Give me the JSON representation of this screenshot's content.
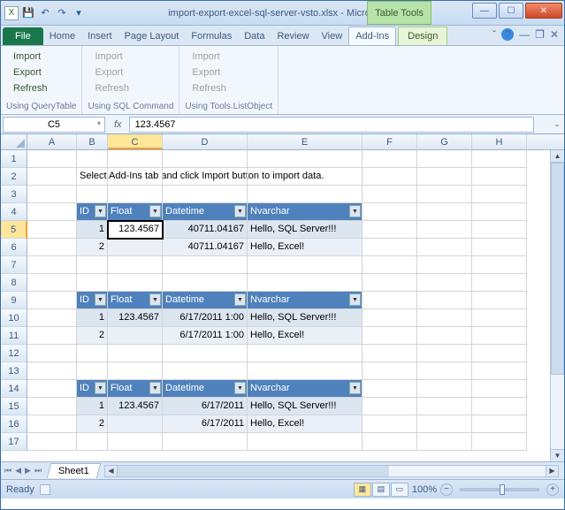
{
  "title": "import-export-excel-sql-server-vsto.xlsx - Microsoft ...",
  "table_tools": "Table Tools",
  "ribbon_tabs": [
    "Home",
    "Insert",
    "Page Layout",
    "Formulas",
    "Data",
    "Review",
    "View",
    "Add-Ins"
  ],
  "active_tab": "Add-Ins",
  "file_tab": "File",
  "design_tab": "Design",
  "ribbon_groups": [
    {
      "label": "Using QueryTable",
      "items": [
        {
          "t": "Import",
          "en": true
        },
        {
          "t": "Export",
          "en": true
        },
        {
          "t": "Refresh",
          "en": true
        }
      ]
    },
    {
      "label": "Using SQL Command",
      "items": [
        {
          "t": "Import",
          "en": false
        },
        {
          "t": "Export",
          "en": false
        },
        {
          "t": "Refresh",
          "en": false
        }
      ]
    },
    {
      "label": "Using Tools.ListObject",
      "items": [
        {
          "t": "Import",
          "en": false
        },
        {
          "t": "Export",
          "en": false
        },
        {
          "t": "Refresh",
          "en": false
        }
      ]
    }
  ],
  "namebox": "C5",
  "formula": "123.4567",
  "columns": [
    "A",
    "B",
    "C",
    "D",
    "E",
    "F",
    "G",
    "H"
  ],
  "selected_col": "C",
  "selected_row": 5,
  "row_count": 17,
  "message": "Select Add-Ins tab  and click Import button to import data.",
  "tables": [
    {
      "header_row": 4,
      "headers": [
        "ID",
        "Float",
        "Datetime",
        "Nvarchar"
      ],
      "rows": [
        {
          "r": 5,
          "v": [
            "1",
            "123.4567",
            "40711.04167",
            "Hello, SQL Server!!!"
          ]
        },
        {
          "r": 6,
          "v": [
            "2",
            "",
            "40711.04167",
            "Hello, Excel!"
          ]
        }
      ]
    },
    {
      "header_row": 9,
      "headers": [
        "ID",
        "Float",
        "Datetime",
        "Nvarchar"
      ],
      "rows": [
        {
          "r": 10,
          "v": [
            "1",
            "123.4567",
            "6/17/2011 1:00",
            "Hello, SQL Server!!!"
          ]
        },
        {
          "r": 11,
          "v": [
            "2",
            "",
            "6/17/2011 1:00",
            "Hello, Excel!"
          ]
        }
      ]
    },
    {
      "header_row": 14,
      "headers": [
        "ID",
        "Float",
        "Datetime",
        "Nvarchar"
      ],
      "rows": [
        {
          "r": 15,
          "v": [
            "1",
            "123.4567",
            "6/17/2011",
            "Hello, SQL Server!!!"
          ]
        },
        {
          "r": 16,
          "v": [
            "2",
            "",
            "6/17/2011",
            "Hello, Excel!"
          ]
        }
      ]
    }
  ],
  "sheet": "Sheet1",
  "status": "Ready",
  "zoom": "100%"
}
